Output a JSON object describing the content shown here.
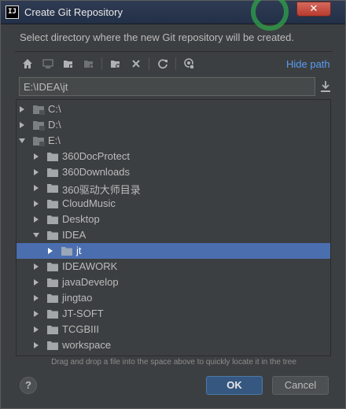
{
  "window": {
    "app_icon_text": "IJ",
    "title": "Create Git Repository",
    "close_label": "✕"
  },
  "description": "Select directory where the new Git repository will be created.",
  "toolbar": {
    "icons": [
      "home-icon",
      "desktop-icon",
      "project-folder-icon",
      "module-folder-icon",
      "new-folder-icon",
      "delete-icon",
      "refresh-icon",
      "show-hidden-icon"
    ],
    "hide_path_label": "Hide path"
  },
  "path": {
    "value": "E:\\IDEA\\jt"
  },
  "tree": {
    "rows": [
      {
        "label": "C:\\",
        "expanded": false,
        "drive": true
      },
      {
        "label": "D:\\",
        "expanded": false,
        "drive": true
      },
      {
        "label": "E:\\",
        "expanded": true,
        "drive": true
      },
      {
        "label": "360DocProtect",
        "expanded": false
      },
      {
        "label": "360Downloads",
        "expanded": false
      },
      {
        "label": "360驱动大师目录",
        "expanded": false
      },
      {
        "label": "CloudMusic",
        "expanded": false
      },
      {
        "label": "Desktop",
        "expanded": false
      },
      {
        "label": "IDEA",
        "expanded": true
      },
      {
        "label": "jt",
        "expanded": false,
        "selected": true
      },
      {
        "label": "IDEAWORK",
        "expanded": false
      },
      {
        "label": "javaDevelop",
        "expanded": false
      },
      {
        "label": "jingtao",
        "expanded": false
      },
      {
        "label": "JT-SOFT",
        "expanded": false
      },
      {
        "label": "TCGBIII",
        "expanded": false
      },
      {
        "label": "workspace",
        "expanded": false
      }
    ]
  },
  "hint": "Drag and drop a file into the space above to quickly locate it in the tree",
  "buttons": {
    "help_label": "?",
    "ok_label": "OK",
    "cancel_label": "Cancel"
  },
  "colors": {
    "background": "#3c3f41",
    "selection": "#4b6eaf",
    "link": "#589df6",
    "ok_button": "#365880"
  }
}
